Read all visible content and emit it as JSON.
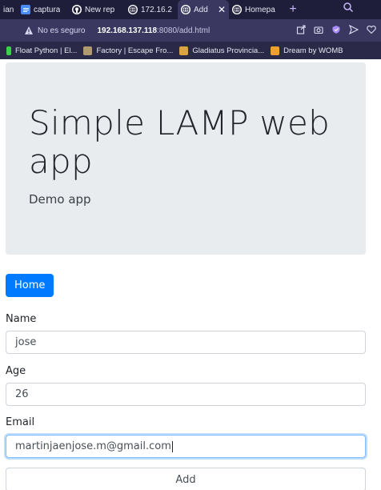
{
  "browser": {
    "tabs": [
      {
        "label": "ian",
        "icon": "partial-tab-icon",
        "color": "#1f1e3a"
      },
      {
        "label": "captura",
        "icon": "docs-icon",
        "color": "#4c8bf5"
      },
      {
        "label": "New rep",
        "icon": "github-icon",
        "color": "#ffffff"
      },
      {
        "label": "172.16.2",
        "icon": "globe-icon",
        "color": "#ffffff"
      },
      {
        "label": "Add",
        "icon": "globe-icon",
        "color": "#ffffff",
        "active": true
      },
      {
        "label": "Homepa",
        "icon": "globe-icon",
        "color": "#ffffff"
      }
    ],
    "new_tab": "+",
    "security_label": "No es seguro",
    "url_host": "192.168.137.118",
    "url_rest": ":8080/add.html",
    "bookmarks": [
      {
        "label": "Float Python | El...",
        "color": "#3ccf4e"
      },
      {
        "label": "Factory | Escape Fro...",
        "color": "#b09a70"
      },
      {
        "label": "Gladiatus Provincia...",
        "color": "#d9a441"
      },
      {
        "label": "Dream by WOMB",
        "color": "#f0a030"
      }
    ]
  },
  "page": {
    "title": "Simple LAMP web app",
    "subtitle": "Demo app",
    "home_button": "Home",
    "form": {
      "name_label": "Name",
      "name_value": "jose",
      "age_label": "Age",
      "age_value": "26",
      "email_label": "Email",
      "email_value": "martinjaenjose.m@gmail.com",
      "submit_label": "Add"
    }
  },
  "colors": {
    "primary": "#007bff",
    "jumbotron_bg": "#e9ecef",
    "tabbar_bg": "#1f1e3a",
    "addressbar_bg": "#3a3860"
  }
}
